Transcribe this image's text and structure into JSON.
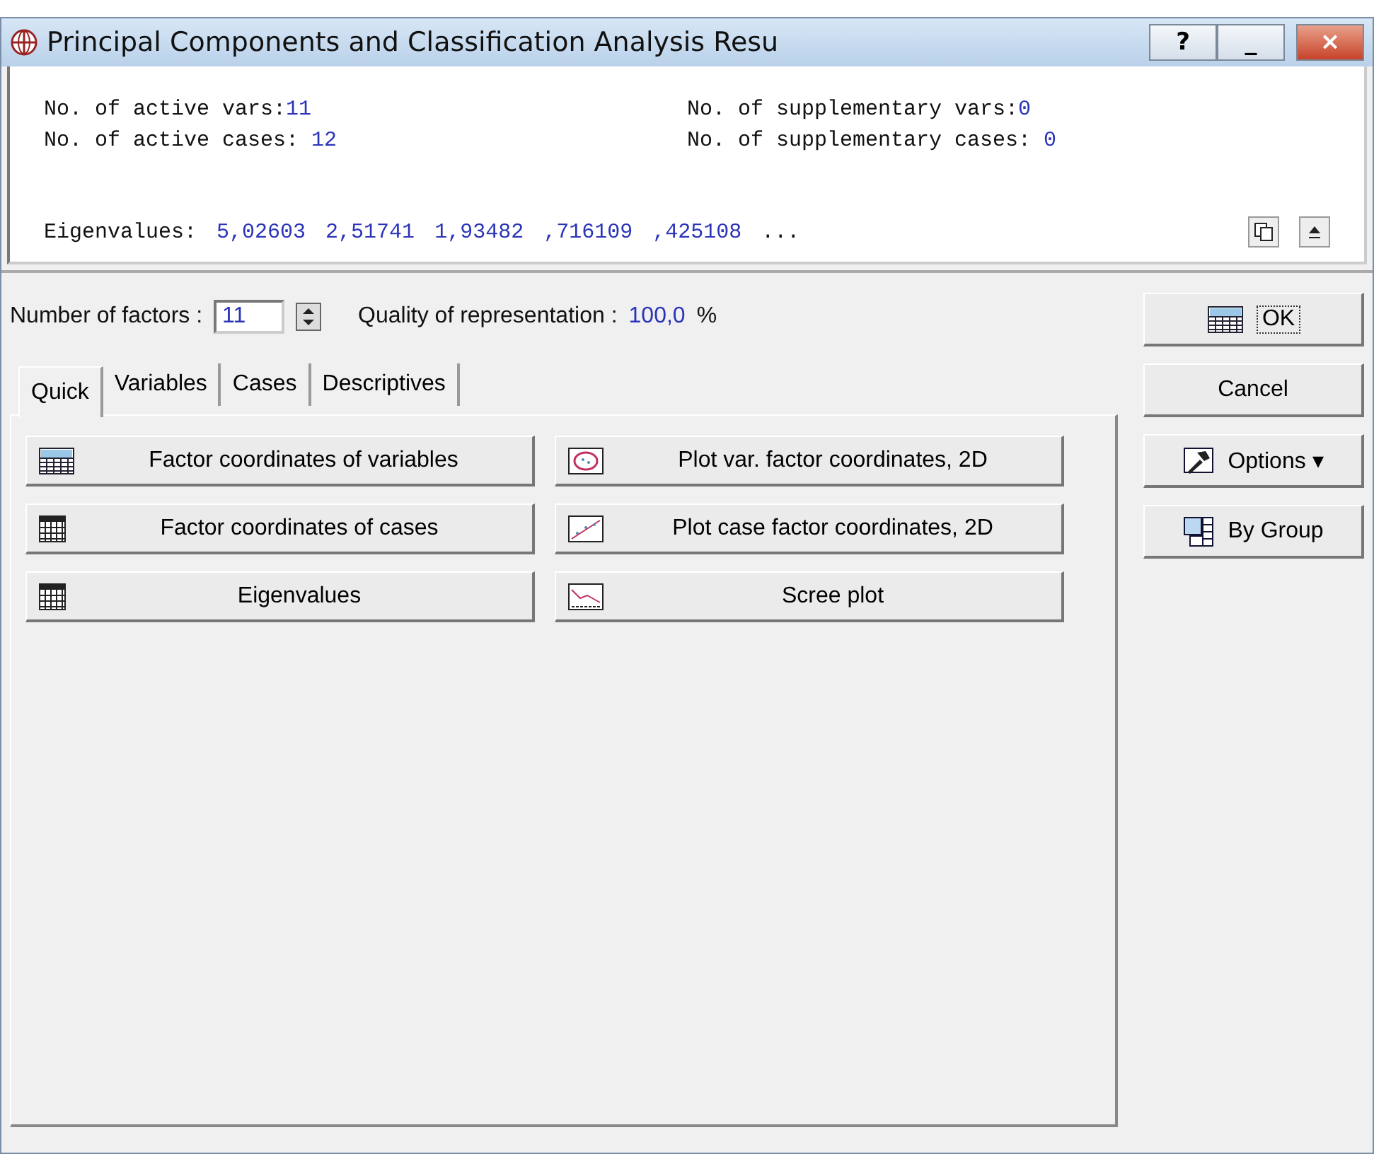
{
  "window": {
    "title": "Principal Components and Classification Analysis Resu",
    "title_buttons": [
      "?",
      "_",
      "×"
    ]
  },
  "summary": {
    "rows": [
      [
        {
          "label": "No. of active vars:",
          "value": "11"
        },
        {
          "label": "No. of supplementary vars:",
          "value": "0"
        }
      ],
      [
        {
          "label": "No. of active cases: ",
          "value": "12"
        },
        {
          "label": "No. of supplementary cases: ",
          "value": "0"
        }
      ]
    ],
    "eigenvalues": {
      "label": "Eigenvalues:",
      "values": [
        "5,02603",
        "2,51741",
        "1,93482",
        ",716109",
        ",425108"
      ],
      "more": "..."
    }
  },
  "factors": {
    "label": "Number of factors :",
    "value": "11",
    "quality_label": "Quality of representation :",
    "quality_value": "100,0",
    "quality_unit": "%"
  },
  "tabs": [
    {
      "label": "Quick",
      "selected": true
    },
    {
      "label": "Variables",
      "selected": false
    },
    {
      "label": "Cases",
      "selected": false
    },
    {
      "label": "Descriptives",
      "selected": false
    }
  ],
  "actions": [
    {
      "label": "Factor coordinates of variables"
    },
    {
      "label": "Plot var. factor coordinates, 2D"
    },
    {
      "label": "Factor coordinates of cases"
    },
    {
      "label": "Plot case factor coordinates, 2D"
    },
    {
      "label": "Eigenvalues"
    },
    {
      "label": "Scree plot"
    }
  ],
  "side_buttons": [
    {
      "label": "OK",
      "focused": true
    },
    {
      "label": "Cancel",
      "focused": false
    },
    {
      "label": "Options",
      "dropdown": "▾",
      "focused": false
    },
    {
      "label": "By Group",
      "focused": false
    }
  ]
}
